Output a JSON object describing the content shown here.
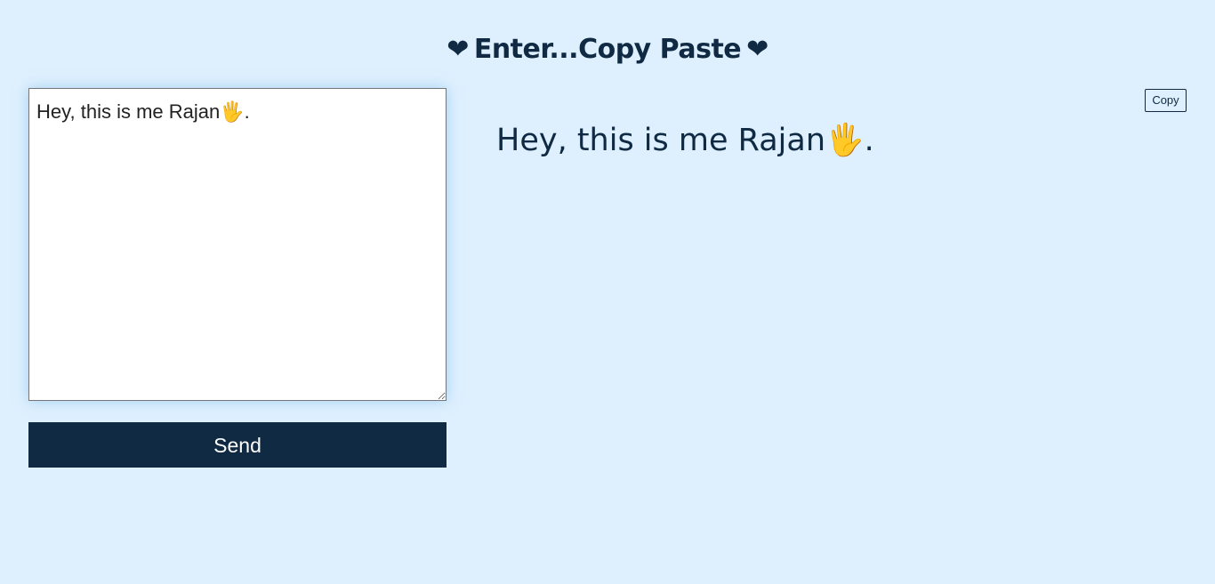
{
  "header": {
    "heart_left": "❤",
    "title": "Enter...Copy Paste",
    "heart_right": "❤"
  },
  "editor": {
    "value": "Hey, this is me Rajan🖐."
  },
  "actions": {
    "send_label": "Send",
    "copy_label": "Copy"
  },
  "output": {
    "text": "Hey, this is me Rajan🖐."
  },
  "colors": {
    "background": "#def0fe",
    "accent": "#0f2a42"
  }
}
